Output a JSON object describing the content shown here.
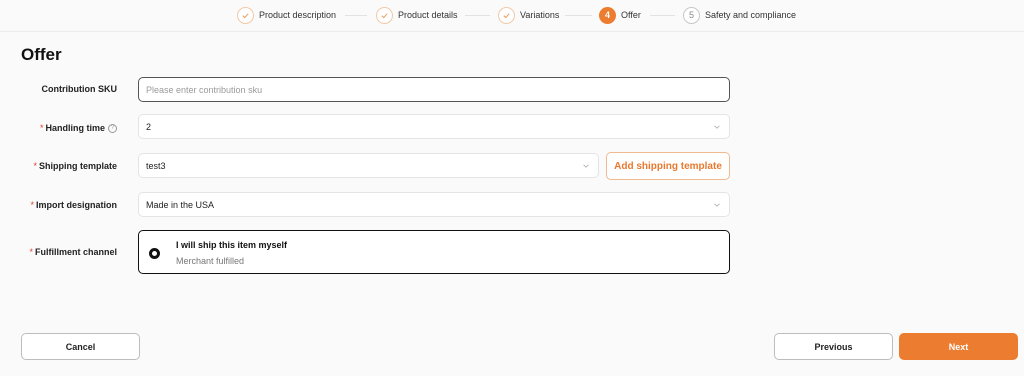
{
  "stepper": {
    "steps": [
      {
        "label": "Product description",
        "state": "done"
      },
      {
        "label": "Product details",
        "state": "done"
      },
      {
        "label": "Variations",
        "state": "done"
      },
      {
        "number": "4",
        "label": "Offer",
        "state": "active"
      },
      {
        "number": "5",
        "label": "Safety and compliance",
        "state": "todo"
      }
    ]
  },
  "page": {
    "title": "Offer"
  },
  "form": {
    "contribution_sku": {
      "label": "Contribution SKU",
      "value": "",
      "placeholder": "Please enter contribution sku"
    },
    "handling_time": {
      "required_mark": "*",
      "label": "Handling time",
      "help_icon": "question-circle-icon",
      "value": "2"
    },
    "shipping_template": {
      "required_mark": "*",
      "label": "Shipping template",
      "value": "test3",
      "add_button": "Add shipping template"
    },
    "import_designation": {
      "required_mark": "*",
      "label": "Import designation",
      "value": "Made in the USA"
    },
    "fulfillment_channel": {
      "required_mark": "*",
      "label": "Fulfillment channel",
      "option_title": "I will ship this item myself",
      "option_subtitle": "Merchant fulfilled",
      "selected": true
    }
  },
  "footer": {
    "cancel": "Cancel",
    "previous": "Previous",
    "next": "Next"
  },
  "colors": {
    "accent": "#ec7c30",
    "required": "#e0402b"
  }
}
